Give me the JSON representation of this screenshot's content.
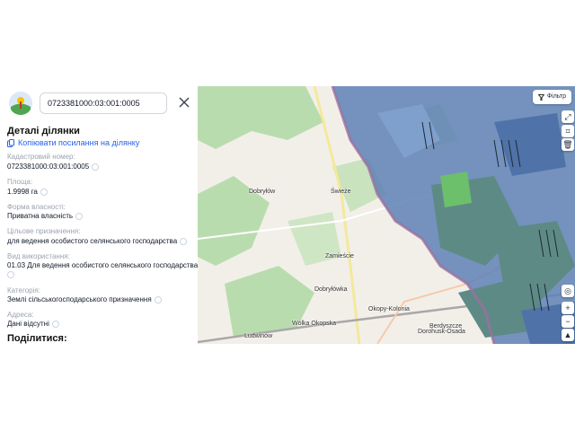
{
  "search": {
    "value": "0723381000:03:001:0005"
  },
  "panel": {
    "title": "Деталі ділянки",
    "copy_link": "Копіювати посилання на ділянку",
    "fields": {
      "cadastral_label": "Кадастровий номер:",
      "cadastral_value": "0723381000:03:001:0005",
      "area_label": "Площа:",
      "area_value": "1.9998 га",
      "ownership_label": "Форма власності:",
      "ownership_value": "Приватна власність",
      "purpose_label": "Цільове призначення:",
      "purpose_value": "для ведення особистого селянського господарства",
      "usage_label": "Вид використання:",
      "usage_value": "01.03 Для ведення особистого селянського господарства",
      "category_label": "Категорія:",
      "category_value": "Землі сільськогосподарського призначення",
      "address_label": "Адреса:",
      "address_value": "Дані відсутні"
    },
    "share": "Поділитися:"
  },
  "map": {
    "filter_label": "Фільтр",
    "places": [
      "Dobryłów",
      "Świeże",
      "Zamieście",
      "Dobryłówka",
      "Okopy-Kolonia",
      "Berdyszcze",
      "Wólka Okopska",
      "Dorohusk-Osada",
      "Ludwinów"
    ],
    "tools": [
      "expand-icon",
      "crop-icon",
      "trash-icon",
      "locate-icon",
      "zoom-in",
      "zoom-out",
      "compass-icon"
    ],
    "colors": {
      "forest": "#b9dcae",
      "land": "#f2efe9",
      "parcel": "#5e81b5",
      "border": "#9b6fa0"
    }
  }
}
